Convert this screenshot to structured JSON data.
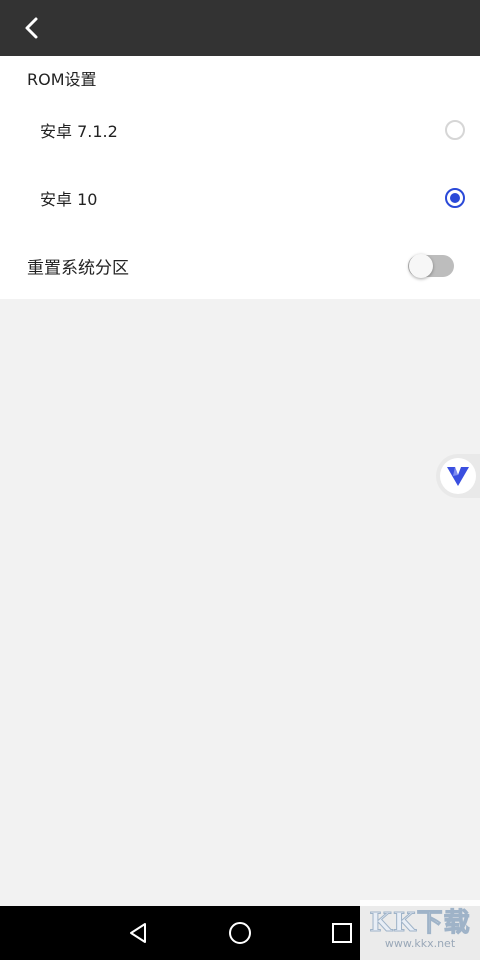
{
  "header": {
    "back_icon": "chevron-left-icon"
  },
  "rom_settings": {
    "title": "ROM设置",
    "options": [
      {
        "label": "安卓 7.1.2",
        "selected": false
      },
      {
        "label": "安卓 10",
        "selected": true
      }
    ],
    "accent_color": "#2a49d8"
  },
  "reset_partition": {
    "label": "重置系统分区",
    "enabled": false
  },
  "floating_button": {
    "icon": "v-logo-icon",
    "color": "#3a4fe0"
  },
  "nav_bar": {
    "icons": [
      "back-triangle-icon",
      "home-circle-icon",
      "recents-square-icon"
    ]
  },
  "watermark": {
    "logo": "KK下载",
    "url": "www.kkx.net"
  },
  "colors": {
    "appbar": "#333333",
    "background": "#f2f2f2",
    "panel": "#ffffff",
    "navbar": "#000000"
  }
}
